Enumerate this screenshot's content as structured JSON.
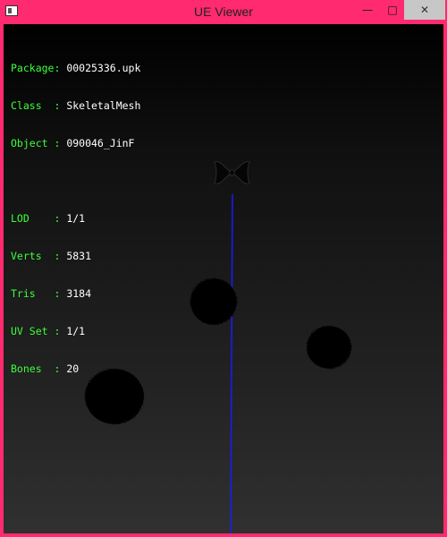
{
  "window": {
    "title": "UE Viewer",
    "controls": {
      "minimize": "—",
      "maximize": "□",
      "close": "✕"
    }
  },
  "info": {
    "header": [
      {
        "label": "Package: ",
        "value": "00025336.upk"
      },
      {
        "label": "Class  : ",
        "value": "SkeletalMesh"
      },
      {
        "label": "Object : ",
        "value": "090046_JinF"
      }
    ],
    "stats": [
      {
        "label": "LOD    : ",
        "value": "1/1"
      },
      {
        "label": "Verts  : ",
        "value": "5831"
      },
      {
        "label": "Tris   : ",
        "value": "3184"
      },
      {
        "label": "UV Set : ",
        "value": "1/1"
      },
      {
        "label": "Bones  : ",
        "value": "20"
      }
    ]
  },
  "colors": {
    "label": "#3cff3c",
    "value": "#ffffff",
    "axis": "#1a1aff",
    "border": "#ff2a6f"
  }
}
